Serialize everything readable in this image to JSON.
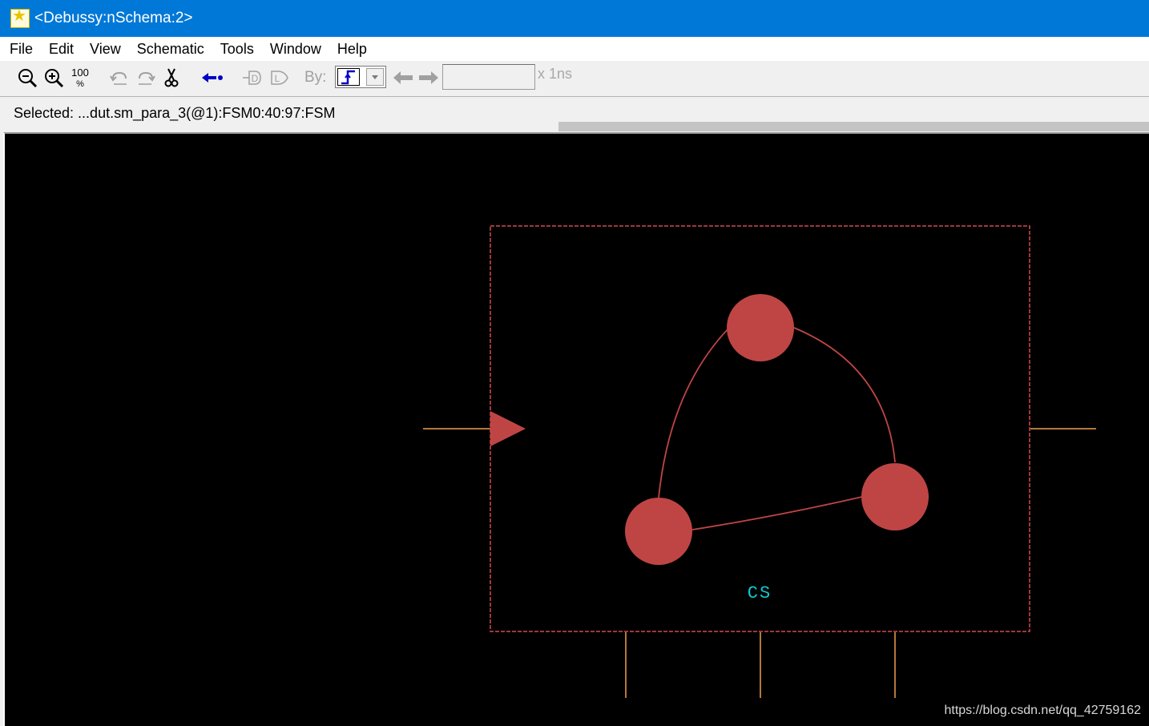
{
  "window": {
    "title": "<Debussy:nSchema:2>"
  },
  "menu": [
    "File",
    "Edit",
    "View",
    "Schematic",
    "Tools",
    "Window",
    "Help"
  ],
  "toolbar": {
    "zoom_100_label": "100\n%",
    "by_label": "By:",
    "time_value": "",
    "time_unit": "x 1ns",
    "icons": [
      "zoom-out-icon",
      "zoom-in-icon",
      "zoom-100-icon",
      "undo-icon",
      "redo-icon",
      "cut-icon",
      "back-trace-icon",
      "driver-icon",
      "load-icon",
      "edge-select-icon",
      "dropdown-icon",
      "previous-icon",
      "next-icon"
    ]
  },
  "status": {
    "selected_text": "Selected: ...dut.sm_para_3(@1):FSM0:40:97:FSM"
  },
  "schematic": {
    "fsm_label": "CS",
    "colors": {
      "state": "#bf4545",
      "box": "#d04a50",
      "wire": "#f0a050",
      "label": "#10c8d0",
      "canvas": "#000000"
    }
  },
  "watermark": "https://blog.csdn.net/qq_42759162"
}
